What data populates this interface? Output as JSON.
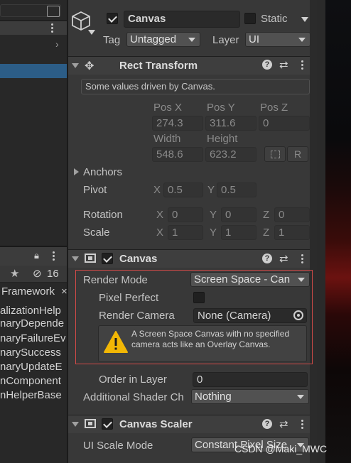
{
  "hierarchy": {
    "rows": [
      "alizationHelp",
      "naryDepende",
      "naryFailureEv",
      "narySuccess",
      "naryUpdateE",
      "nComponent",
      "nHelperBase"
    ],
    "framework_tab": "Framework",
    "favorites_count": "16"
  },
  "header": {
    "object_name": "Canvas",
    "static_label": "Static",
    "tag_label": "Tag",
    "tag_value": "Untagged",
    "layer_label": "Layer",
    "layer_value": "UI"
  },
  "rect_transform": {
    "title": "Rect Transform",
    "driven_note": "Some values driven by Canvas.",
    "pos_x_label": "Pos X",
    "pos_y_label": "Pos Y",
    "pos_z_label": "Pos Z",
    "pos_x": "274.3",
    "pos_y": "311.6",
    "pos_z": "0",
    "width_label": "Width",
    "height_label": "Height",
    "width": "548.6",
    "height": "623.2",
    "r_button": "R",
    "anchors_label": "Anchors",
    "pivot_label": "Pivot",
    "pivot_x": "0.5",
    "pivot_y": "0.5",
    "rotation_label": "Rotation",
    "rotation_x": "0",
    "rotation_y": "0",
    "rotation_z": "0",
    "scale_label": "Scale",
    "scale_x": "1",
    "scale_y": "1",
    "scale_z": "1",
    "axis_x": "X",
    "axis_y": "Y",
    "axis_z": "Z"
  },
  "canvas": {
    "title": "Canvas",
    "render_mode_label": "Render Mode",
    "render_mode_value": "Screen Space - Can",
    "pixel_perfect_label": "Pixel Perfect",
    "render_camera_label": "Render Camera",
    "render_camera_value": "None (Camera)",
    "warning_text": "A Screen Space Canvas with no specified camera acts like an Overlay Canvas.",
    "order_in_layer_label": "Order in Layer",
    "order_in_layer_value": "0",
    "additional_shader_label": "Additional Shader Ch",
    "additional_shader_value": "Nothing"
  },
  "canvas_scaler": {
    "title": "Canvas Scaler",
    "ui_scale_mode_label": "UI Scale Mode",
    "ui_scale_mode_value": "Constant Pixel Size"
  },
  "watermark": "CSDN @Maki_MWC",
  "colors": {
    "highlight_border": "#d24a48",
    "selection": "#2c5d87",
    "warning": "#f2b705"
  }
}
